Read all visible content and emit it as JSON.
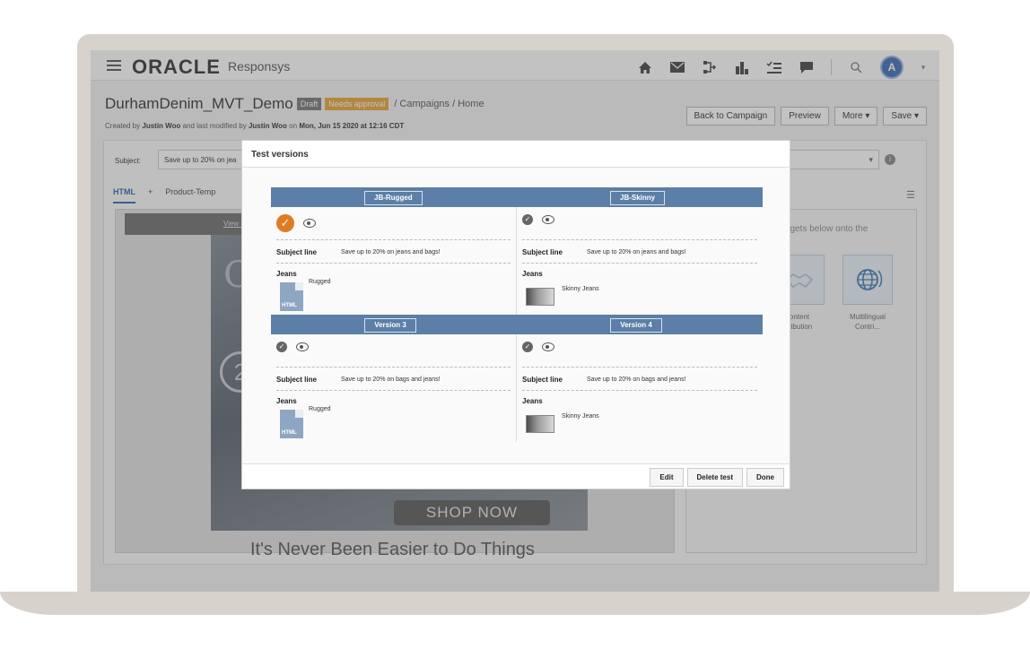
{
  "app": {
    "logo": "ORACLE",
    "product": "Responsys",
    "avatar_initial": "A"
  },
  "nav_icons": [
    "home-icon",
    "mail-icon",
    "program-icon",
    "chart-icon",
    "checklist-icon",
    "chat-icon",
    "search-icon"
  ],
  "page": {
    "title": "DurhamDenim_MVT_Demo",
    "badge_draft": "Draft",
    "badge_approval": "Needs approval",
    "breadcrumb": "/ Campaigns / Home",
    "meta_prefix": "Created by",
    "meta_creator": "Justin Woo",
    "meta_mid": "and last modified by",
    "meta_modifier": "Justin Woo",
    "meta_on": "on",
    "meta_date": "Mon, Jun 15 2020 at 12:16 CDT"
  },
  "actions": {
    "back": "Back to Campaign",
    "preview": "Preview",
    "more": "More ▾",
    "save": "Save ▾"
  },
  "editor": {
    "subject_label": "Subject:",
    "subject_value": "Save up to 20% on jea",
    "tabs": [
      "HTML",
      "+",
      "Product-Temp"
    ],
    "canvas_link": "View in",
    "email_script": "C",
    "email_circle": "2",
    "shop_now": "SHOP NOW",
    "headline": "It's Never Been Easier to Do Things",
    "widgets_hint": "dgets below onto the",
    "widget_1": "ontent\ntribution",
    "widget_2": "Multilingual\nContri..."
  },
  "modal": {
    "title": "Test versions",
    "subject_line_label": "Subject line",
    "jeans_label": "Jeans",
    "versions": [
      {
        "name": "JB-Rugged",
        "subject": "Save up to 20% on jeans and bags!",
        "content": "Rugged",
        "selected": true
      },
      {
        "name": "JB-Skinny",
        "subject": "Save up to 20% on jeans and bags!",
        "content": "Skinny Jeans",
        "selected": false
      },
      {
        "name": "Version 3",
        "subject": "Save up to 20% on bags and jeans!",
        "content": "Rugged",
        "selected": false
      },
      {
        "name": "Version 4",
        "subject": "Save up to 20% on bags and jeans!",
        "content": "Skinny Jeans",
        "selected": false
      }
    ],
    "html_tag": "HTML",
    "edit": "Edit",
    "delete": "Delete test",
    "done": "Done"
  },
  "colors": {
    "version_header": "#5b7fa6",
    "selected_check": "#e07b24",
    "approval_badge": "#e8a53a",
    "avatar": "#3c6fb5"
  }
}
